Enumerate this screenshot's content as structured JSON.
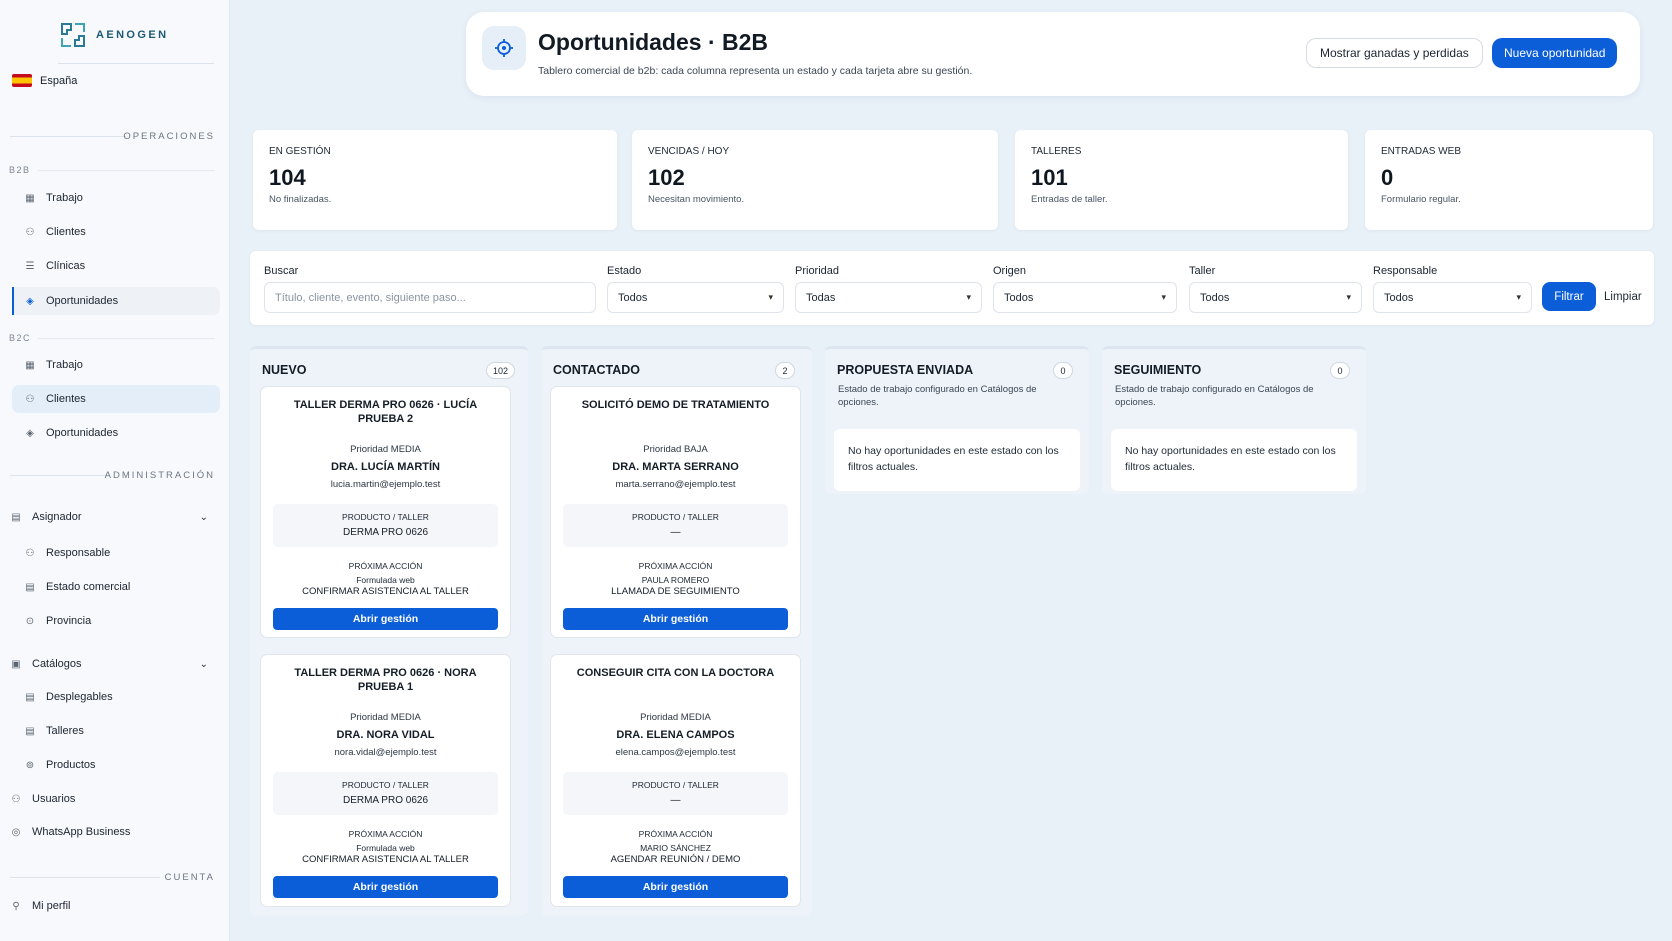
{
  "brand": {
    "name": "AENOGEN"
  },
  "country": "España",
  "sidebar": {
    "operaciones": "OPERACIONES",
    "b2b": "B2B",
    "b2b_items": [
      "Trabajo",
      "Clientes",
      "Clínicas",
      "Oportunidades"
    ],
    "b2c": "B2C",
    "b2c_items": [
      "Trabajo",
      "Clientes",
      "Oportunidades"
    ],
    "administracion": "ADMINISTRACIÓN",
    "asignador": "Asignador",
    "asignador_items": [
      "Responsable",
      "Estado comercial",
      "Provincia"
    ],
    "catalogos": "Catálogos",
    "catalogos_items": [
      "Desplegables",
      "Talleres",
      "Productos"
    ],
    "usuarios": "Usuarios",
    "whatsapp": "WhatsApp Business",
    "cuenta": "CUENTA",
    "perfil": "Mi perfil"
  },
  "header": {
    "title": "Oportunidades · B2B",
    "subtitle": "Tablero comercial de b2b: cada columna representa un estado y cada tarjeta abre su gestión.",
    "show_button": "Mostrar ganadas y perdidas",
    "new_button": "Nueva oportunidad"
  },
  "stats": [
    {
      "label": "EN GESTIÓN",
      "value": "104",
      "caption": "No finalizadas."
    },
    {
      "label": "VENCIDAS / HOY",
      "value": "102",
      "caption": "Necesitan movimiento."
    },
    {
      "label": "TALLERES",
      "value": "101",
      "caption": "Entradas de taller."
    },
    {
      "label": "ENTRADAS WEB",
      "value": "0",
      "caption": "Formulario regular."
    }
  ],
  "filters": {
    "search_label": "Buscar",
    "search_placeholder": "Título, cliente, evento, siguiente paso...",
    "estado_label": "Estado",
    "estado_value": "Todos",
    "prioridad_label": "Prioridad",
    "prioridad_value": "Todas",
    "origen_label": "Origen",
    "origen_value": "Todos",
    "taller_label": "Taller",
    "taller_value": "Todos",
    "responsable_label": "Responsable",
    "responsable_value": "Todos",
    "filter_button": "Filtrar",
    "clear_button": "Limpiar"
  },
  "columns": {
    "nuevo": {
      "title": "NUEVO",
      "count": "102",
      "cards": [
        {
          "title": "TALLER DERMA PRO 0626 · LUCÍA PRUEBA 2",
          "priority": "Prioridad MEDIA",
          "name": "DRA. LUCÍA MARTÍN",
          "email": "lucia.martin@ejemplo.test",
          "product_label": "PRODUCTO / TALLER",
          "product": "DERMA PRO 0626",
          "next_label": "PRÓXIMA ACCIÓN",
          "next_who": "Formulada web",
          "next_action": "CONFIRMAR ASISTENCIA AL TALLER",
          "button": "Abrir gestión"
        },
        {
          "title": "TALLER DERMA PRO 0626 · NORA PRUEBA 1",
          "priority": "Prioridad MEDIA",
          "name": "DRA. NORA VIDAL",
          "email": "nora.vidal@ejemplo.test",
          "product_label": "PRODUCTO / TALLER",
          "product": "DERMA PRO 0626",
          "next_label": "PRÓXIMA ACCIÓN",
          "next_who": "Formulada web",
          "next_action": "CONFIRMAR ASISTENCIA AL TALLER",
          "button": "Abrir gestión"
        }
      ]
    },
    "contactado": {
      "title": "CONTACTADO",
      "count": "2",
      "cards": [
        {
          "title": "SOLICITÓ DEMO DE TRATAMIENTO",
          "priority": "Prioridad BAJA",
          "name": "DRA. MARTA SERRANO",
          "email": "marta.serrano@ejemplo.test",
          "product_label": "PRODUCTO / TALLER",
          "product": "—",
          "next_label": "PRÓXIMA ACCIÓN",
          "next_who": "PAULA ROMERO",
          "next_action": "LLAMADA DE SEGUIMIENTO",
          "button": "Abrir gestión"
        },
        {
          "title": "CONSEGUIR CITA CON LA DOCTORA",
          "priority": "Prioridad MEDIA",
          "name": "DRA. ELENA CAMPOS",
          "email": "elena.campos@ejemplo.test",
          "product_label": "PRODUCTO / TALLER",
          "product": "—",
          "next_label": "PRÓXIMA ACCIÓN",
          "next_who": "MARIO SÁNCHEZ",
          "next_action": "AGENDAR REUNIÓN / DEMO",
          "button": "Abrir gestión"
        }
      ]
    },
    "propuesta": {
      "title": "PROPUESTA ENVIADA",
      "count": "0",
      "description": "Estado de trabajo configurado en Catálogos de opciones.",
      "empty": "No hay oportunidades en este estado con los filtros actuales."
    },
    "seguimiento": {
      "title": "SEGUIMIENTO",
      "count": "0",
      "description": "Estado de trabajo configurado en Catálogos de opciones.",
      "empty": "No hay oportunidades en este estado con los filtros actuales."
    }
  },
  "colors": {
    "primary": "#0b5ed7",
    "background": "#e8f0f8"
  }
}
